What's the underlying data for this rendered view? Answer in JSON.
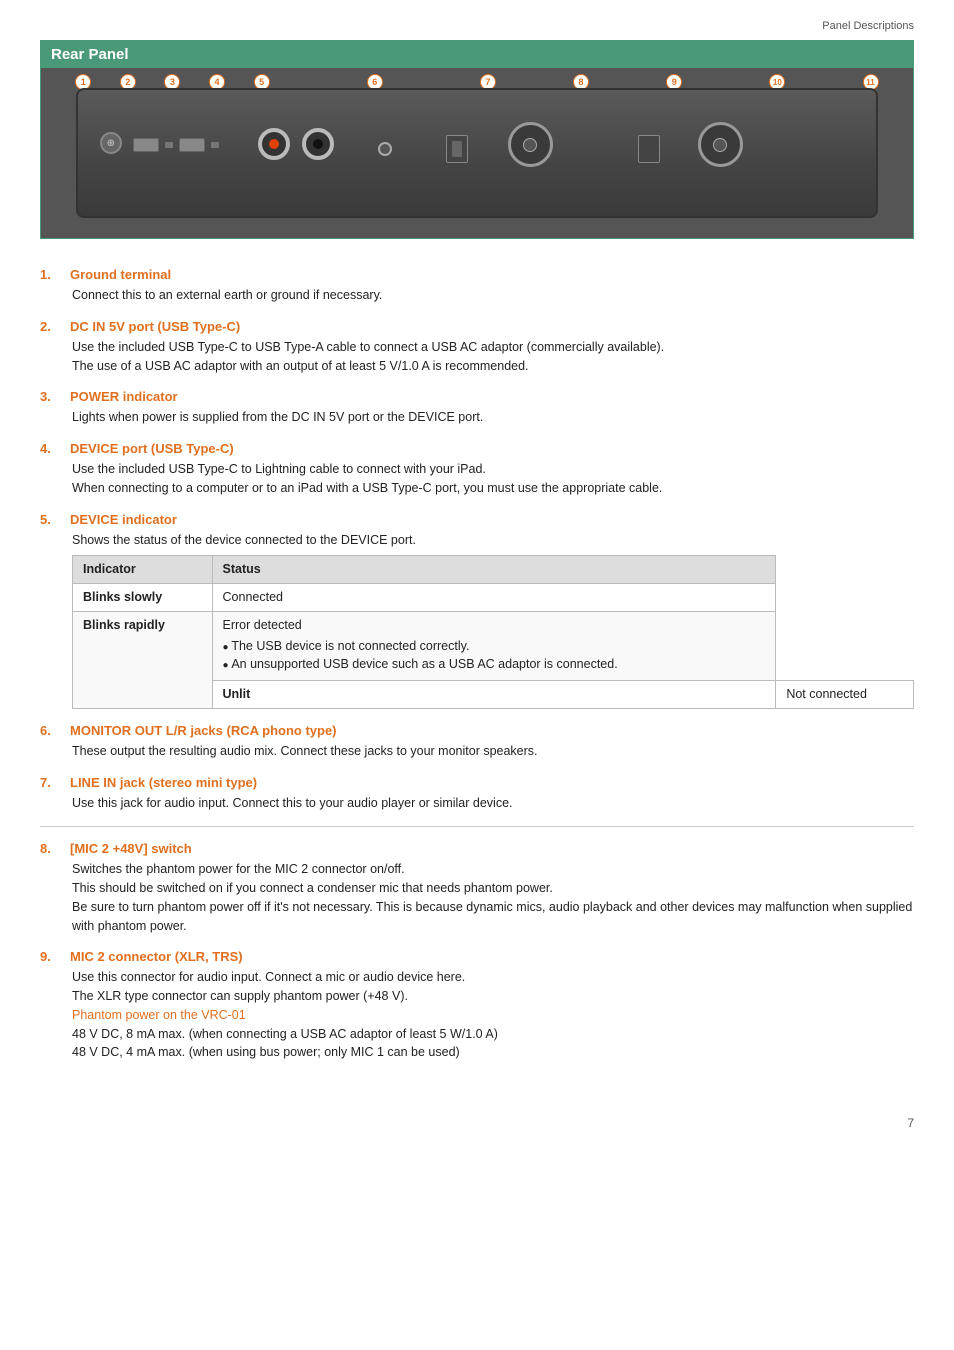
{
  "header": {
    "section": "Panel Descriptions"
  },
  "rear_panel": {
    "title": "Rear Panel"
  },
  "items": [
    {
      "num": "1.",
      "title": "Ground terminal",
      "body": "Connect this to an external earth or ground if necessary."
    },
    {
      "num": "2.",
      "title": "DC IN 5V port (USB Type-C)",
      "body": "Use the included USB Type-C to USB Type-A cable to connect a USB AC adaptor (commercially available).\nThe use of a USB AC adaptor with an output of at least 5 V/1.0 A is recommended."
    },
    {
      "num": "3.",
      "title": "POWER indicator",
      "body": "Lights when power is supplied from the DC IN 5V port or the DEVICE port."
    },
    {
      "num": "4.",
      "title": "DEVICE port (USB Type-C)",
      "body": "Use the included USB Type-C to Lightning cable to connect with your iPad.\nWhen connecting to a computer or to an iPad with a USB Type-C port, you must use the appropriate cable."
    },
    {
      "num": "5.",
      "title": "DEVICE indicator",
      "body": "Shows the status of the device connected to the DEVICE port."
    },
    {
      "num": "6.",
      "title": "MONITOR OUT L/R jacks (RCA phono type)",
      "body": "These output the resulting audio mix. Connect these jacks to your monitor speakers."
    },
    {
      "num": "7.",
      "title": "LINE IN jack (stereo mini type)",
      "body": "Use this jack for audio input. Connect this to your audio player or similar device."
    },
    {
      "num": "8.",
      "title": "[MIC 2 +48V] switch",
      "body": "Switches the phantom power for the MIC 2 connector on/off.\nThis should be switched on if you connect a condenser mic that needs phantom power.\nBe sure to turn phantom power off if it's not necessary. This is because dynamic mics, audio playback and other devices may malfunction when supplied with phantom power."
    },
    {
      "num": "9.",
      "title": "MIC 2 connector (XLR, TRS)",
      "body": "Use this connector for audio input. Connect a mic or audio device here.\nThe XLR type connector can supply phantom power (+48 V).",
      "link": "Phantom power on the VRC-01",
      "extra": "48 V DC, 8 mA max. (when connecting a USB AC adaptor of least 5 W/1.0 A)\n48 V DC, 4 mA max. (when using bus power; only MIC 1 can be used)"
    }
  ],
  "table": {
    "headers": [
      "Indicator",
      "Status"
    ],
    "rows": [
      {
        "indicator": "Blinks slowly",
        "status": "Connected",
        "bullets": []
      },
      {
        "indicator": "",
        "status": "Error detected",
        "bullets": [
          "The USB device is not connected correctly.",
          "An unsupported USB device such as a USB AC adaptor is connected."
        ]
      },
      {
        "indicator": "Blinks rapidly",
        "status": "",
        "bullets": []
      },
      {
        "indicator": "Unlit",
        "status": "Not connected",
        "bullets": []
      }
    ]
  },
  "page_number": "7"
}
